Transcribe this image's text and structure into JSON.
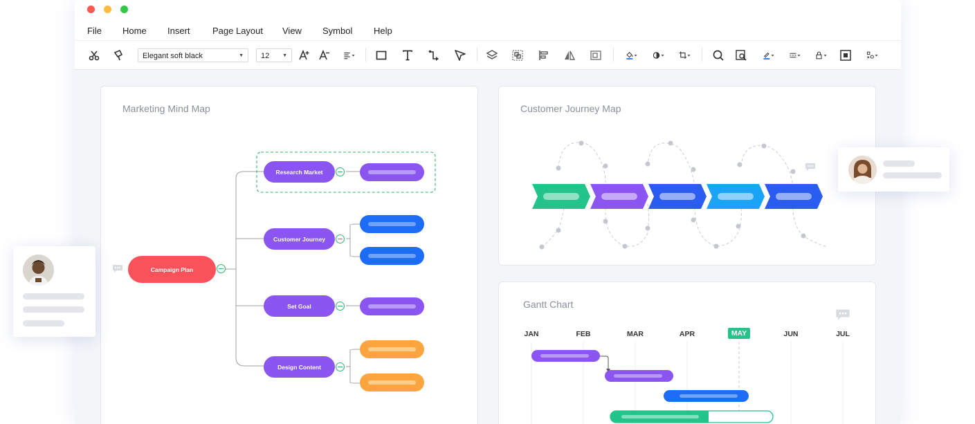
{
  "menu": {
    "file": "File",
    "home": "Home",
    "insert": "Insert",
    "page_layout": "Page Layout",
    "view": "View",
    "symbol": "Symbol",
    "help": "Help"
  },
  "toolbar": {
    "font_family": "Elegant soft black",
    "font_size": "12"
  },
  "mindmap": {
    "title": "Marketing Mind Map",
    "root": "Campaign Plan",
    "branches": [
      "Research Market",
      "Customer Journey",
      "Set Goal",
      "Design Content"
    ]
  },
  "journey": {
    "title": "Customer Journey Map",
    "stage_colors": [
      "#22c48a",
      "#8a55f0",
      "#2b5cf0",
      "#19a4f5",
      "#2b5cf0"
    ]
  },
  "gantt": {
    "title": "Gantt Chart",
    "months": [
      "JAN",
      "FEB",
      "MAR",
      "APR",
      "MAY",
      "JUN",
      "JUL"
    ],
    "highlight_month": "MAY",
    "highlight_color": "#22c48a"
  },
  "colors": {
    "root": "#f9525a",
    "branch": "#8a55f0",
    "blue": "#1c6cf5",
    "orange": "#fca53e",
    "green": "#22c48a"
  }
}
